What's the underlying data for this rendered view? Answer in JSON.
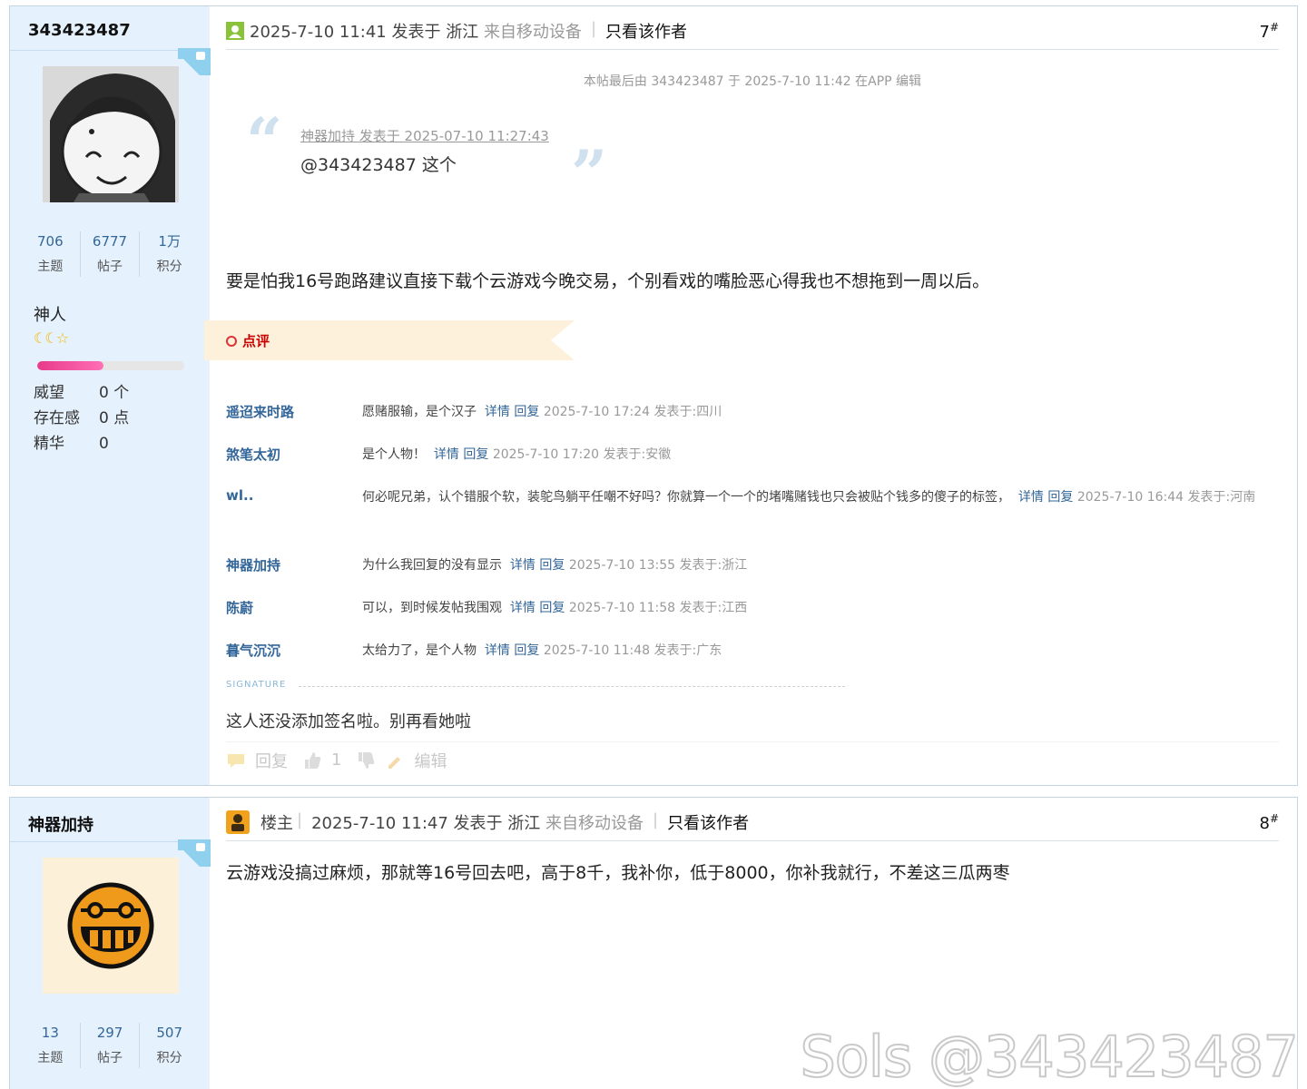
{
  "posts": [
    {
      "author": "343423487",
      "stats": [
        {
          "num": "706",
          "label": "主题"
        },
        {
          "num": "6777",
          "label": "帖子"
        },
        {
          "num": "1万",
          "label": "积分"
        }
      ],
      "rank": "神人",
      "level_fill": 0.45,
      "attrs": [
        {
          "k": "威望",
          "v": "0 个"
        },
        {
          "k": "存在感",
          "v": "0 点"
        },
        {
          "k": "精华",
          "v": "0"
        }
      ],
      "header": {
        "datetime": "2025-7-10 11:41 发表于 浙江",
        "device": "来自移动设备",
        "only_author": "只看该作者",
        "floor": "7",
        "floor_mark": "#"
      },
      "edit_note": "本帖最后由 343423487 于 2025-7-10 11:42 在APP 编辑",
      "quote": {
        "meta": "神器加持 发表于 2025-07-10 11:27:43",
        "text": "@343423487 这个"
      },
      "content": "要是怕我16号跑路建议直接下载个云游戏今晚交易，个别看戏的嘴脸恶心得我也不想拖到一周以后。",
      "comments_label": "点评",
      "comments": [
        {
          "user": "遥迢来时路",
          "text": "愿赌服输，是个汉子",
          "detail": "详情",
          "reply": "回复",
          "time": "2025-7-10 17:24 发表于:四川"
        },
        {
          "user": "煞笔太初",
          "text": "是个人物！",
          "detail": "详情",
          "reply": "回复",
          "time": "2025-7-10 17:20 发表于:安徽"
        },
        {
          "user": "wl..",
          "text": "何必呢兄弟，认个错服个软，装鸵鸟躺平任嘲不好吗？你就算一个一个的堵嘴赌钱也只会被贴个钱多的傻子的标签，",
          "detail": "详情",
          "reply": "回复",
          "time": "2025-7-10 16:44 发表于:河南"
        },
        {
          "user": "神器加持",
          "text": "为什么我回复的没有显示",
          "detail": "详情",
          "reply": "回复",
          "time": "2025-7-10 13:55 发表于:浙江"
        },
        {
          "user": "陈蔚",
          "text": "可以，到时候发帖我围观",
          "detail": "详情",
          "reply": "回复",
          "time": "2025-7-10 11:58 发表于:江西"
        },
        {
          "user": "暮气沉沉",
          "text": "太给力了，是个人物",
          "detail": "详情",
          "reply": "回复",
          "time": "2025-7-10 11:48 发表于:广东"
        }
      ],
      "signature_label": "SIGNATURE",
      "signature": "这人还没添加签名啦。别再看她啦",
      "footer": {
        "reply": "回复",
        "likes": "1",
        "edit": "编辑"
      }
    },
    {
      "author": "神器加持",
      "stats": [
        {
          "num": "13",
          "label": "主题"
        },
        {
          "num": "297",
          "label": "帖子"
        },
        {
          "num": "507",
          "label": "积分"
        }
      ],
      "header": {
        "owner_label": "楼主",
        "datetime": "2025-7-10 11:47 发表于 浙江",
        "device": "来自移动设备",
        "only_author": "只看该作者",
        "floor": "8",
        "floor_mark": "#"
      },
      "content": "云游戏没搞过麻烦，那就等16号回去吧，高于8千，我补你，低于8000，你补我就行，不差这三瓜两枣"
    }
  ],
  "watermark": "Sols @343423487",
  "colors": {
    "sidebar_bg": "#e5f1fc",
    "link": "#336699",
    "border": "#c2d5e3",
    "comment_label": "#cc0000"
  }
}
